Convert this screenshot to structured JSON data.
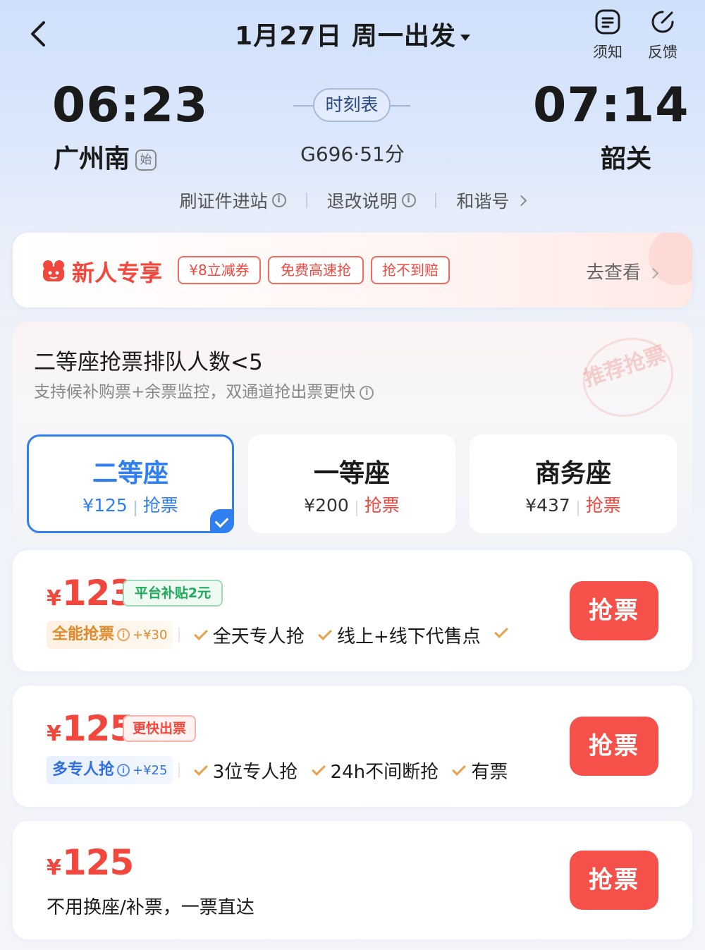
{
  "header": {
    "date_title": "1月27日 周一出发",
    "notice_label": "须知",
    "feedback_label": "反馈"
  },
  "train": {
    "dep_time": "06:23",
    "arr_time": "07:14",
    "dep_station": "广州南",
    "start_badge": "始",
    "arr_station": "韶关",
    "schedule_label": "时刻表",
    "train_info": "G696·51分"
  },
  "links": {
    "id_entry": "刷证件进站",
    "refund": "退改说明",
    "train_name": "和谐号"
  },
  "promo": {
    "title": "新人专享",
    "tags": [
      "¥8立减券",
      "免费高速抢",
      "抢不到赔"
    ],
    "go_label": "去查看"
  },
  "queue": {
    "title": "二等座抢票排队人数<5",
    "subtitle": "支持候补购票+余票监控，双通道抢出票更快",
    "stamp": "推荐抢票"
  },
  "seats": [
    {
      "name": "二等座",
      "price": "¥125",
      "action": "抢票",
      "selected": true
    },
    {
      "name": "一等座",
      "price": "¥200",
      "action": "抢票",
      "selected": false
    },
    {
      "name": "商务座",
      "price": "¥437",
      "action": "抢票",
      "selected": false
    }
  ],
  "offers": [
    {
      "currency": "¥",
      "price": "123",
      "tag": "平台补贴2元",
      "badge": "全能抢票",
      "badge_extra": "+¥30",
      "features": [
        "全天专人抢",
        "线上+线下代售点"
      ],
      "button": "抢票"
    },
    {
      "currency": "¥",
      "price": "125",
      "tag": "更快出票",
      "badge": "多专人抢",
      "badge_extra": "+¥25",
      "features": [
        "3位专人抢",
        "24h不间断抢",
        "有票"
      ],
      "button": "抢票"
    },
    {
      "currency": "¥",
      "price": "125",
      "desc": "不用换座/补票，一票直达",
      "button": "抢票"
    }
  ],
  "colors": {
    "accent_red": "#f2473d",
    "accent_blue": "#2f7ff0",
    "subsidy_green": "#1eaa5c",
    "badge_orange": "#e08a2c"
  }
}
